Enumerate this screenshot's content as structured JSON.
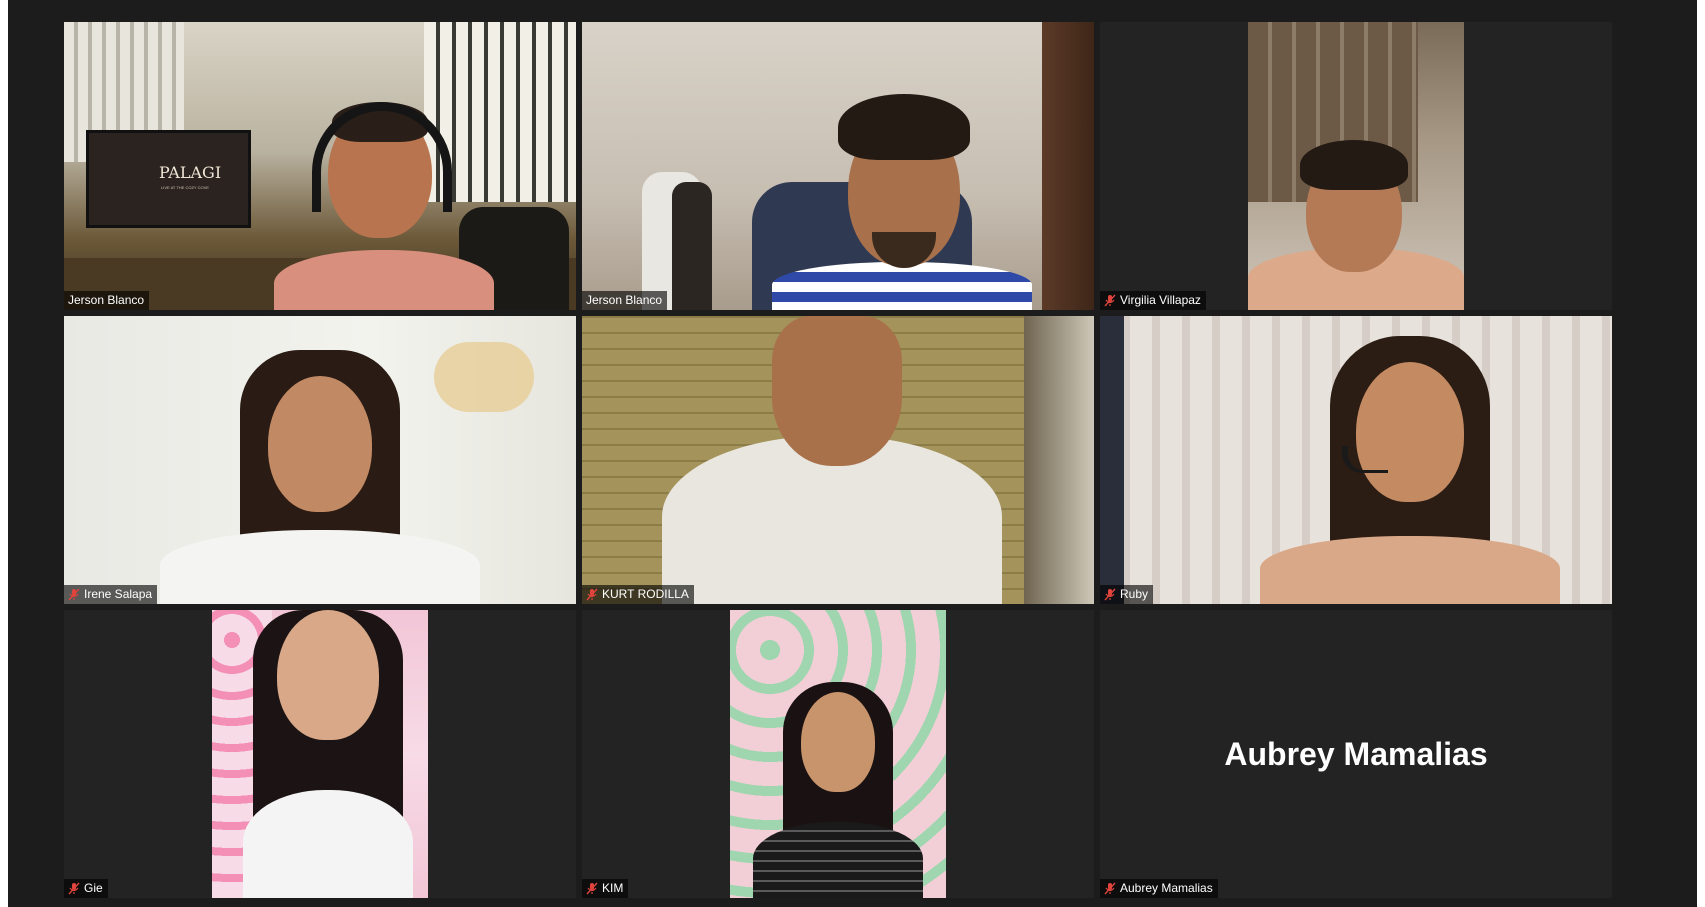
{
  "meeting": {
    "participants": [
      {
        "name": "Jerson Blanco",
        "muted": false,
        "active_speaker": false
      },
      {
        "name": "Jerson Blanco",
        "muted": false,
        "active_speaker": true
      },
      {
        "name": "Virgilia Villapaz",
        "muted": true,
        "active_speaker": false
      },
      {
        "name": "Irene Salapa",
        "muted": true,
        "active_speaker": false
      },
      {
        "name": "KURT RODILLA",
        "muted": true,
        "active_speaker": false
      },
      {
        "name": "Ruby",
        "muted": true,
        "active_speaker": false
      },
      {
        "name": "Gie",
        "muted": true,
        "active_speaker": false
      },
      {
        "name": "KIM",
        "muted": true,
        "active_speaker": false
      },
      {
        "name": "Aubrey Mamalias",
        "muted": true,
        "active_speaker": false,
        "video_off": true
      }
    ],
    "tv_screen": {
      "title": "PALAGI",
      "subtitle": "LIVE AT THE COZY COVE"
    },
    "colors": {
      "active_speaker_border": "#e6e07a",
      "mute_icon": "#e0443c",
      "tile_background": "#232323"
    },
    "icons": {
      "mute": "muted-microphone-icon"
    }
  }
}
